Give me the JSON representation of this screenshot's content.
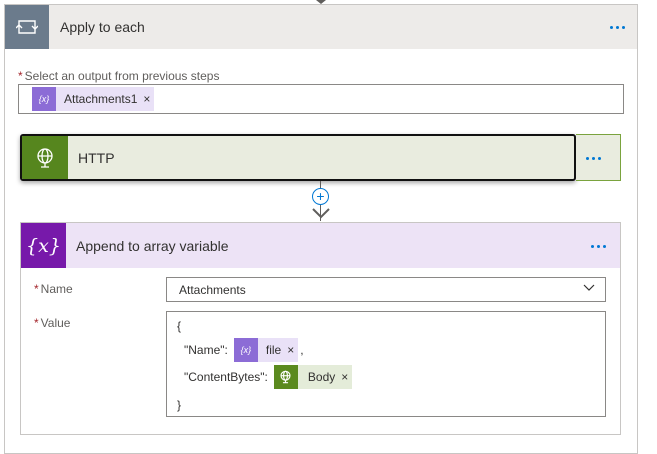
{
  "apply_to_each": {
    "title": "Apply to each",
    "output_label": "Select an output from previous steps",
    "required_mark": "*",
    "token": {
      "label": "Attachments1",
      "icon": "variable-icon",
      "close": "×"
    }
  },
  "http_action": {
    "title": "HTTP",
    "icon": "globe-icon"
  },
  "append_action": {
    "title": "Append to array variable",
    "icon_glyph": "{x}",
    "name_label": "Name",
    "name_value": "Attachments",
    "value_label": "Value",
    "value_lines": {
      "open_brace": "{",
      "name_key": "\"Name\":",
      "name_token": "file",
      "comma": ",",
      "content_key": "\"ContentBytes\":",
      "content_token": "Body",
      "close_brace": "}"
    },
    "token_close": "×"
  },
  "colors": {
    "accent": "#0078d4",
    "variable": "#8c6cd6",
    "http": "#56861e",
    "append": "#7719aa"
  }
}
